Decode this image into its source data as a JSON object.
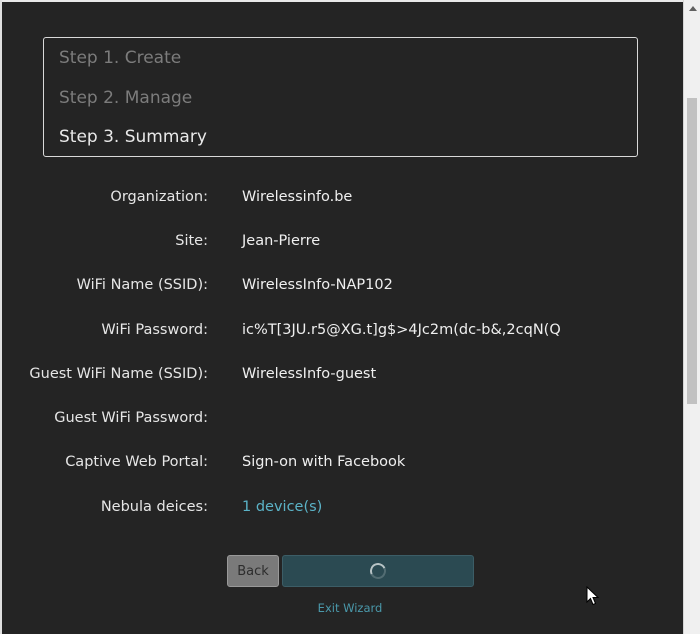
{
  "wizard": {
    "steps": [
      {
        "label": "Step 1. Create"
      },
      {
        "label": "Step 2. Manage"
      },
      {
        "label": "Step 3. Summary"
      }
    ]
  },
  "summary": {
    "organization": {
      "label": "Organization:",
      "value": "Wirelessinfo.be"
    },
    "site": {
      "label": "Site:",
      "value": "Jean-Pierre"
    },
    "wifi_name": {
      "label": "WiFi Name (SSID):",
      "value": "WirelessInfo-NAP102"
    },
    "wifi_password": {
      "label": "WiFi Password:",
      "value": "ic%T[3JU.r5@XG.t]g$>4Jc2m(dc-b&,2cqN(Q"
    },
    "guest_wifi_name": {
      "label": "Guest WiFi Name (SSID):",
      "value": "WirelessInfo-guest"
    },
    "guest_wifi_password": {
      "label": "Guest WiFi Password:",
      "value": ""
    },
    "captive_portal": {
      "label": "Captive Web Portal:",
      "value": "Sign-on with Facebook"
    },
    "nebula_devices": {
      "label": "Nebula deices:",
      "value": "1 device(s)"
    }
  },
  "actions": {
    "back_label": "Back",
    "exit_label": "Exit Wizard"
  },
  "colors": {
    "background": "#242424",
    "accent_link": "#5bb3c7",
    "next_button": "#2b4a52",
    "step_inactive": "#7c7c7c",
    "step_active": "#e9e9e9"
  },
  "icons": {
    "loading": "spinner-icon",
    "cursor": "mouse-pointer-icon"
  }
}
